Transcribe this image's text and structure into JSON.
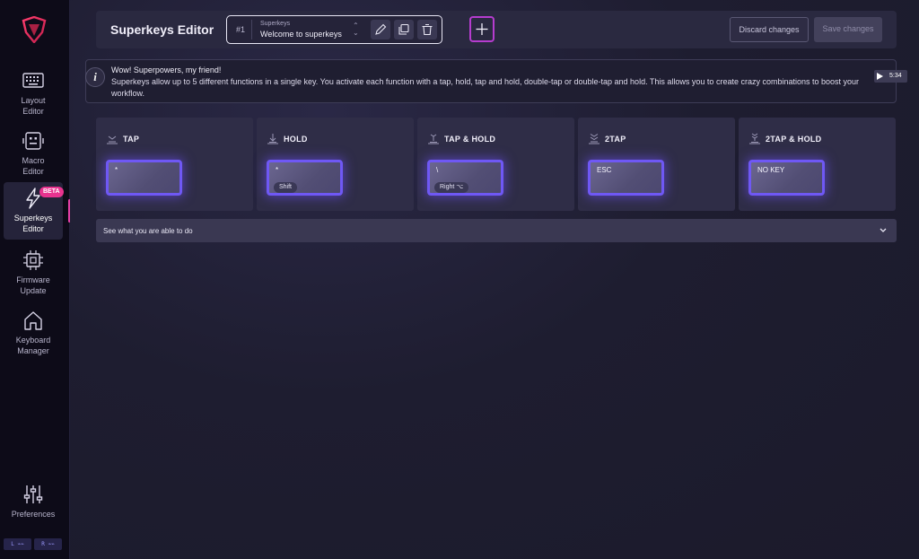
{
  "sidebar": {
    "items": [
      {
        "label": "Layout\nEditor",
        "icon": "keyboard-icon"
      },
      {
        "label": "Macro\nEditor",
        "icon": "robot-icon"
      },
      {
        "label": "Superkeys\nEditor",
        "icon": "lightning-icon",
        "badge": "BETA",
        "active": true
      },
      {
        "label": "Firmware\nUpdate",
        "icon": "chip-icon"
      },
      {
        "label": "Keyboard\nManager",
        "icon": "home-icon"
      }
    ],
    "preferences": "Preferences",
    "status": [
      "L",
      "R"
    ]
  },
  "header": {
    "title": "Superkeys Editor",
    "selector": {
      "id": "#1",
      "small": "Superkeys",
      "name": "Welcome to superkeys"
    },
    "discard": "Discard changes",
    "save": "Save changes"
  },
  "info": {
    "title": "Wow! Superpowers, my friend!",
    "text": "Superkeys allow up to 5 different functions in a single key. You activate each function with a tap, hold, tap and hold, double-tap or double-tap and hold. This allows you to create crazy combinations to boost your workflow.",
    "video_time": "5:34"
  },
  "actions": [
    {
      "title": "TAP",
      "key": "*",
      "modifier": ""
    },
    {
      "title": "HOLD",
      "key": "*",
      "modifier": "Shift"
    },
    {
      "title": "TAP & HOLD",
      "key": "\\",
      "modifier": "Right ⌥"
    },
    {
      "title": "2TAP",
      "key": "ESC",
      "modifier": ""
    },
    {
      "title": "2TAP & HOLD",
      "key": "NO KEY",
      "modifier": ""
    }
  ],
  "accordion": {
    "label": "See what you are able to do"
  },
  "colors": {
    "accent": "#6f58f5",
    "brand": "#e8338f"
  }
}
